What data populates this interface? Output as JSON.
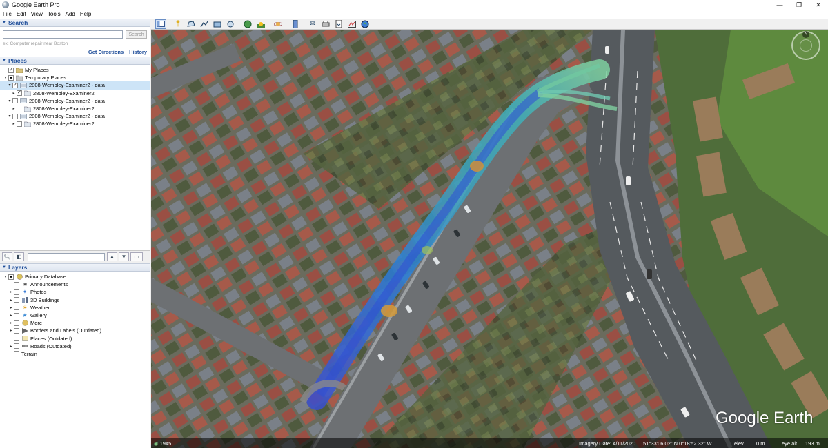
{
  "window": {
    "title": "Google Earth Pro",
    "minimize": "—",
    "maximize": "❐",
    "close": "✕"
  },
  "menu": [
    "File",
    "Edit",
    "View",
    "Tools",
    "Add",
    "Help"
  ],
  "search": {
    "header": "Search",
    "button": "Search",
    "placeholder_hint": "ex: Computer repair near Boston",
    "get_directions": "Get Directions",
    "history": "History"
  },
  "places": {
    "header": "Places",
    "items": [
      {
        "label": "My Places",
        "checked": "✓",
        "expand": ""
      },
      {
        "label": "Temporary Places",
        "checked": "■",
        "expand": "▾"
      },
      {
        "label": "2808-Wembley-Examiner2 - data",
        "checked": "✓",
        "expand": "▾"
      },
      {
        "label": "2808-Wembley-Examiner2",
        "checked": "✓",
        "expand": "▸"
      },
      {
        "label": "2808-Wembley-Examiner2 - data",
        "checked": "",
        "expand": "▾"
      },
      {
        "label": "2808-Wembley-Examiner2",
        "checked": "",
        "expand": "▸"
      },
      {
        "label": "2808-Wembley-Examiner2 - data",
        "checked": "",
        "expand": "▾"
      },
      {
        "label": "2808-Wembley-Examiner2",
        "checked": "",
        "expand": "▸"
      }
    ]
  },
  "layers": {
    "header": "Layers",
    "items": [
      {
        "label": "Primary Database"
      },
      {
        "label": "Announcements"
      },
      {
        "label": "Photos"
      },
      {
        "label": "3D Buildings"
      },
      {
        "label": "Weather"
      },
      {
        "label": "Gallery"
      },
      {
        "label": "More"
      },
      {
        "label": "Borders and Labels (Outdated)"
      },
      {
        "label": "Places (Outdated)"
      },
      {
        "label": "Roads (Outdated)"
      },
      {
        "label": "Terrain"
      }
    ]
  },
  "status": {
    "year": "1945",
    "imagery_date": "Imagery Date: 4/11/2020",
    "coords": "51°33'06.02\" N   0°18'52.32\" W",
    "elev": "elev",
    "elev_value": "0 m",
    "eye_alt": "eye alt",
    "eye_alt_value": "193 m"
  },
  "map": {
    "logo": "Google Earth",
    "compass_n": "N"
  }
}
